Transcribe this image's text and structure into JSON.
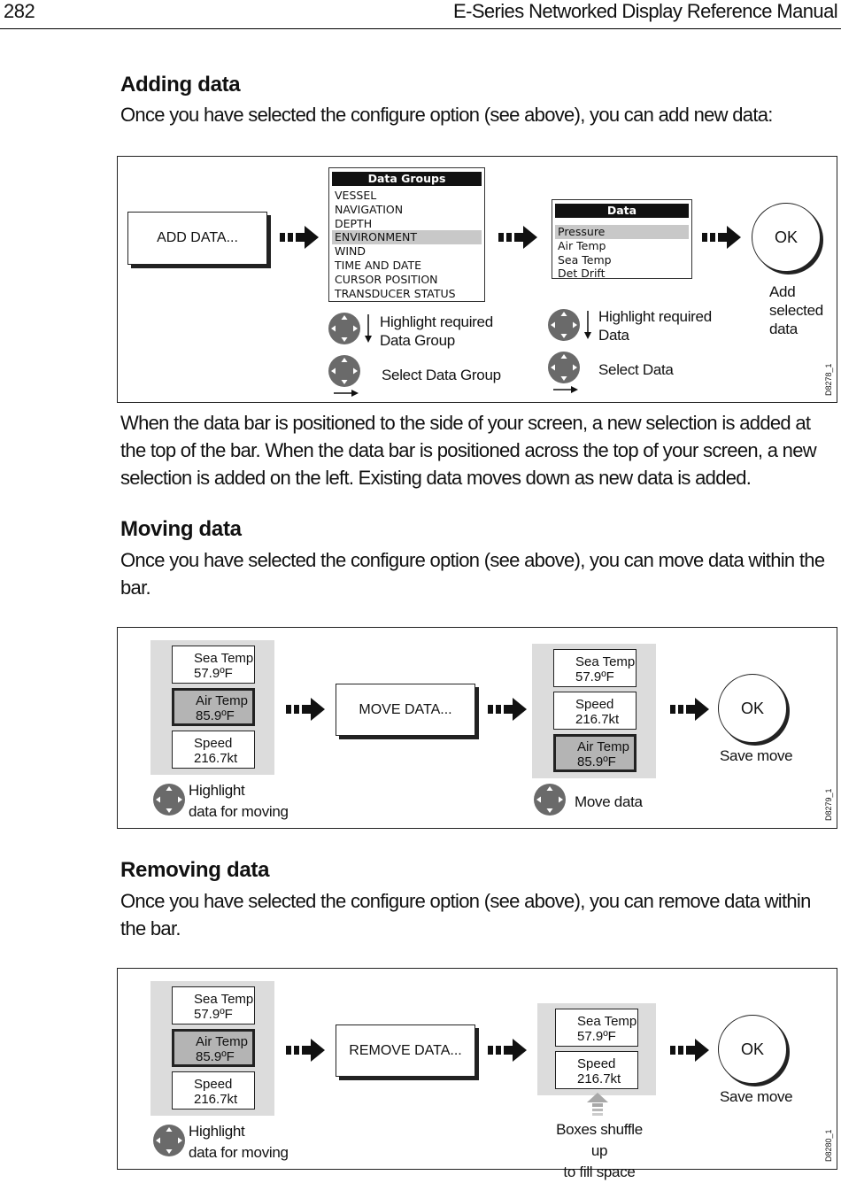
{
  "header": {
    "page_number": "282",
    "manual_title": "E-Series Networked Display Reference Manual"
  },
  "adding": {
    "heading": "Adding data",
    "intro": "Once you have selected the configure option (see above), you can add new data:",
    "add_button": "ADD DATA...",
    "data_groups_menu": {
      "title": "Data Groups",
      "items": [
        "VESSEL",
        "NAVIGATION",
        "DEPTH",
        "ENVIRONMENT",
        "WIND",
        "TIME AND DATE",
        "CURSOR POSITION",
        "TRANSDUCER STATUS"
      ],
      "selected": "ENVIRONMENT"
    },
    "data_menu": {
      "title": "Data",
      "items": [
        "Pressure",
        "Air Temp",
        "Sea Temp",
        "Det Drift"
      ],
      "selected": "Pressure"
    },
    "ok_label": "OK",
    "ok_caption": [
      "Add",
      "selected",
      "data"
    ],
    "step1_highlight": [
      "Highlight required",
      "Data Group"
    ],
    "step1_select": "Select Data Group",
    "step2_highlight": [
      "Highlight required",
      "Data"
    ],
    "step2_select": "Select Data",
    "figure_code": "D8278_1",
    "after_text": "When the data bar is positioned to the side of your screen, a new selection is added at the top of the bar. When the data bar is positioned across the top of your screen, a new selection is added on the left. Existing data moves down as new data is added."
  },
  "moving": {
    "heading": "Moving data",
    "intro": "Once you have selected the configure option (see above), you can move data within the bar.",
    "before_bar": [
      {
        "label": "Sea Temp",
        "value": "57.9ºF",
        "highlighted": false
      },
      {
        "label": "Air Temp",
        "value": "85.9ºF",
        "highlighted": true
      },
      {
        "label": "Speed",
        "value": "216.7kt",
        "highlighted": false
      }
    ],
    "move_button": "MOVE DATA...",
    "after_bar": [
      {
        "label": "Sea Temp",
        "value": "57.9ºF",
        "highlighted": false
      },
      {
        "label": "Speed",
        "value": "216.7kt",
        "highlighted": false
      },
      {
        "label": "Air Temp",
        "value": "85.9ºF",
        "highlighted": true
      }
    ],
    "ok_label": "OK",
    "ok_caption": "Save move",
    "highlight_caption": [
      "Highlight",
      "data for moving"
    ],
    "move_caption": "Move data",
    "figure_code": "D8279_1"
  },
  "removing": {
    "heading": "Removing data",
    "intro": "Once you have selected the configure option (see above), you can remove data within the bar.",
    "before_bar": [
      {
        "label": "Sea Temp",
        "value": "57.9ºF",
        "highlighted": false
      },
      {
        "label": "Air Temp",
        "value": "85.9ºF",
        "highlighted": true
      },
      {
        "label": "Speed",
        "value": "216.7kt",
        "highlighted": false
      }
    ],
    "remove_button": "REMOVE DATA...",
    "after_bar": [
      {
        "label": "Sea Temp",
        "value": "57.9ºF",
        "highlighted": false
      },
      {
        "label": "Speed",
        "value": "216.7kt",
        "highlighted": false
      }
    ],
    "ok_label": "OK",
    "ok_caption": "Save move",
    "highlight_caption": [
      "Highlight",
      "data for moving"
    ],
    "shuffle_caption": [
      "Boxes shuffle up",
      "to fill space"
    ],
    "figure_code": "D8280_1"
  }
}
